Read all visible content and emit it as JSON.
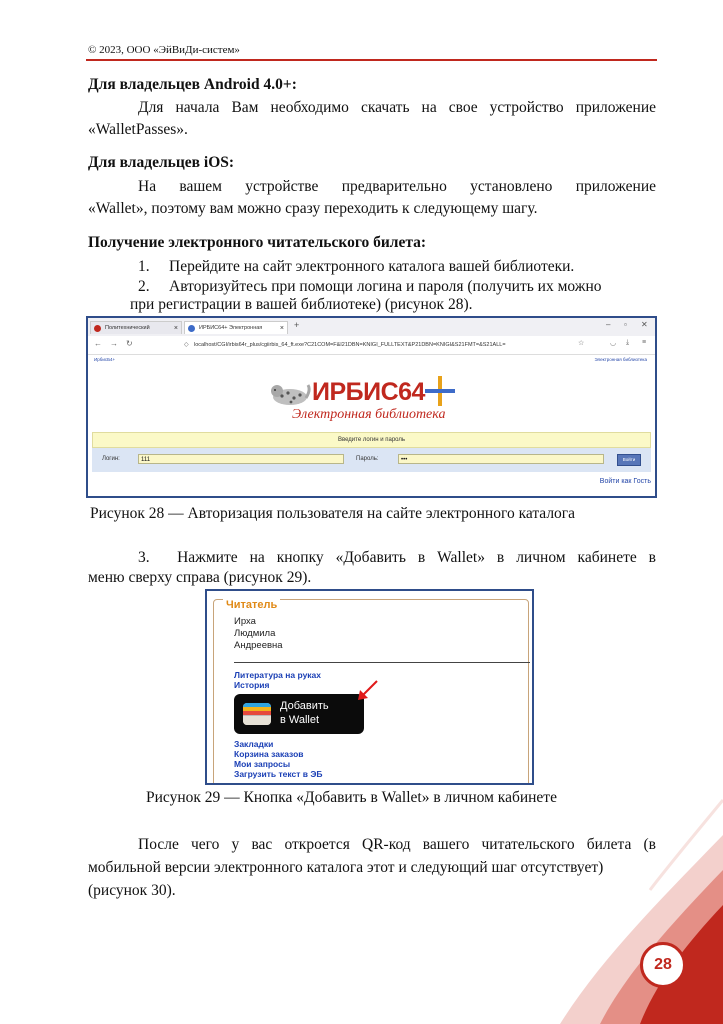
{
  "header": {
    "copyright": "© 2023, ООО «ЭйВиДи-систем»"
  },
  "android": {
    "heading": "Для владельцев Android 4.0+:",
    "line1": "Для начала Вам необходимо скачать на свое устройство приложение",
    "line2": "«WalletPasses»."
  },
  "ios": {
    "heading": "Для владельцев iOS:",
    "line1": "На вашем устройстве предварительно установлено приложение",
    "line2": "«Wallet», поэтому вам можно сразу переходить к следующему шагу."
  },
  "ticket": {
    "heading": "Получение электронного читательского билета:",
    "step1": "1.  Перейдите на сайт электронного каталога вашей библиотеки.",
    "step2a": "2.  Авторизуйтесь при помощи логина и пароля (получить их можно",
    "step2b": "при регистрации в вашей библиотеке) (рисунок 28)."
  },
  "fig28": {
    "tab1": "Политехнический подразделе",
    "tab2": "ИРБИС64+ Электронная библиотека",
    "new_tab": "+",
    "url": "localhost/CGI/irbis64r_plus/cgiirbis_64_ft.exe?C21COM=F&I21DBN=KNIGI_FULLTEXT&P21DBN=KNIGI&S21FMT=&S21ALL=",
    "bookmark_left": "ИрбисБ4+",
    "bookmark_right": "Электронная библиотека",
    "logo_text": "ИРБИС64",
    "logo_sub": "Электронная библиотека",
    "login_prompt": "Введите логин и пароль",
    "login_label": "Логин:",
    "login_value": "111",
    "password_label": "Пароль:",
    "password_value": "•••",
    "enter_button": "Войти",
    "guest_link": "Войти как Гость"
  },
  "caption28": "Рисунок 28 — Авторизация пользователя на сайте электронного каталога",
  "step3": {
    "line1": "3.  Нажмите на кнопку «Добавить в Wallet» в личном кабинете в",
    "line2": "меню сверху справа (рисунок 29)."
  },
  "fig29": {
    "legend": "Читатель",
    "name1": "Ирха",
    "name2": "Людмила",
    "name3": "Андреевна",
    "link_literature": "Литература на руках",
    "link_history": "История",
    "wallet_line1": "Добавить",
    "wallet_line2": "в Wallet",
    "link_bookmarks": "Закладки",
    "link_cart": "Корзина заказов",
    "link_requests": "Мои запросы",
    "link_upload": "Загрузить текст в ЭБ"
  },
  "caption29": "Рисунок 29 — Кнопка «Добавить в Wallet» в личном кабинете",
  "after": {
    "line1": "После чего у вас откроется QR-код вашего читательского билета (в",
    "line2": "мобильной версии электронного каталога этот и следующий шаг отсутствует)",
    "line3": "(рисунок 30)."
  },
  "page_number": "28",
  "colors": {
    "accent": "#c0281e",
    "frame": "#2f4d8a",
    "link": "#1a3fb5"
  }
}
